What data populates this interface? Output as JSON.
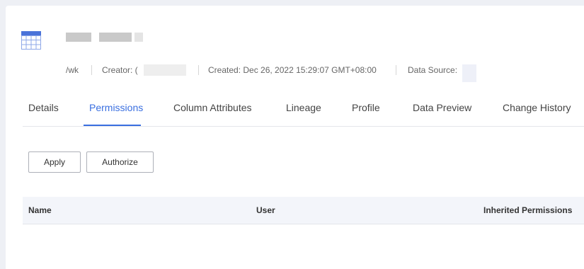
{
  "header": {
    "path_label": "/wk",
    "creator_label": "Creator: (",
    "created_label": "Created: Dec 26, 2022 15:29:07 GMT+08:00",
    "data_source_label": "Data Source:"
  },
  "tabs": [
    {
      "label": "Details",
      "active": false
    },
    {
      "label": "Permissions",
      "active": true
    },
    {
      "label": "Column Attributes",
      "active": false
    },
    {
      "label": "Lineage",
      "active": false
    },
    {
      "label": "Profile",
      "active": false
    },
    {
      "label": "Data Preview",
      "active": false
    },
    {
      "label": "Change History",
      "active": false
    }
  ],
  "toolbar": {
    "apply_label": "Apply",
    "authorize_label": "Authorize"
  },
  "table": {
    "columns": [
      "Name",
      "User",
      "Inherited Permissions"
    ],
    "rows": []
  },
  "colors": {
    "accent": "#3a6fe0",
    "background": "#eef0f5",
    "header_row": "#f3f5fa"
  }
}
